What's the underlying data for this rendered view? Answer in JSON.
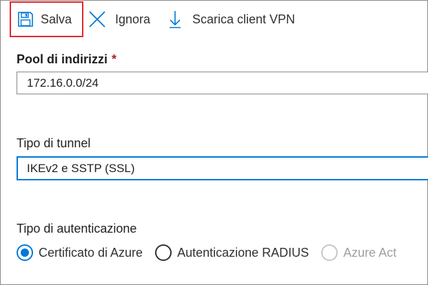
{
  "toolbar": {
    "save_label": "Salva",
    "discard_label": "Ignora",
    "download_label": "Scarica client VPN"
  },
  "address_pool": {
    "label": "Pool di indirizzi",
    "required_marker": "*",
    "value": "172.16.0.0/24"
  },
  "tunnel_type": {
    "label": "Tipo di tunnel",
    "value": "IKEv2 e SSTP (SSL)"
  },
  "auth_type": {
    "label": "Tipo di autenticazione",
    "options": [
      {
        "label": "Certificato di Azure",
        "checked": true,
        "disabled": false
      },
      {
        "label": "Autenticazione RADIUS",
        "checked": false,
        "disabled": false
      },
      {
        "label": "Azure Act",
        "checked": false,
        "disabled": true
      }
    ]
  },
  "colors": {
    "accent": "#0078d4",
    "highlight_box": "#e3262c",
    "required": "#a4262c",
    "disabled": "#a19f9d"
  },
  "icons": {
    "save": "floppy-disk-icon",
    "discard": "x-icon",
    "download": "download-arrow-icon"
  }
}
